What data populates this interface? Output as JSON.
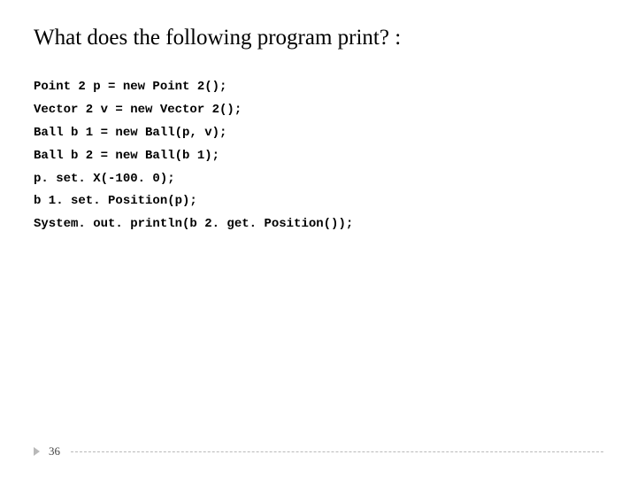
{
  "title": "What does the following program print? :",
  "code": {
    "l1": "Point 2 p = new Point 2();",
    "l2": "Vector 2 v = new Vector 2();",
    "l3": "Ball b 1 = new Ball(p, v);",
    "l4": "Ball b 2 = new Ball(b 1);",
    "l5": "p. set. X(-100. 0);",
    "l6": "b 1. set. Position(p);",
    "l7": "System. out. println(b 2. get. Position());"
  },
  "page_number": "36"
}
